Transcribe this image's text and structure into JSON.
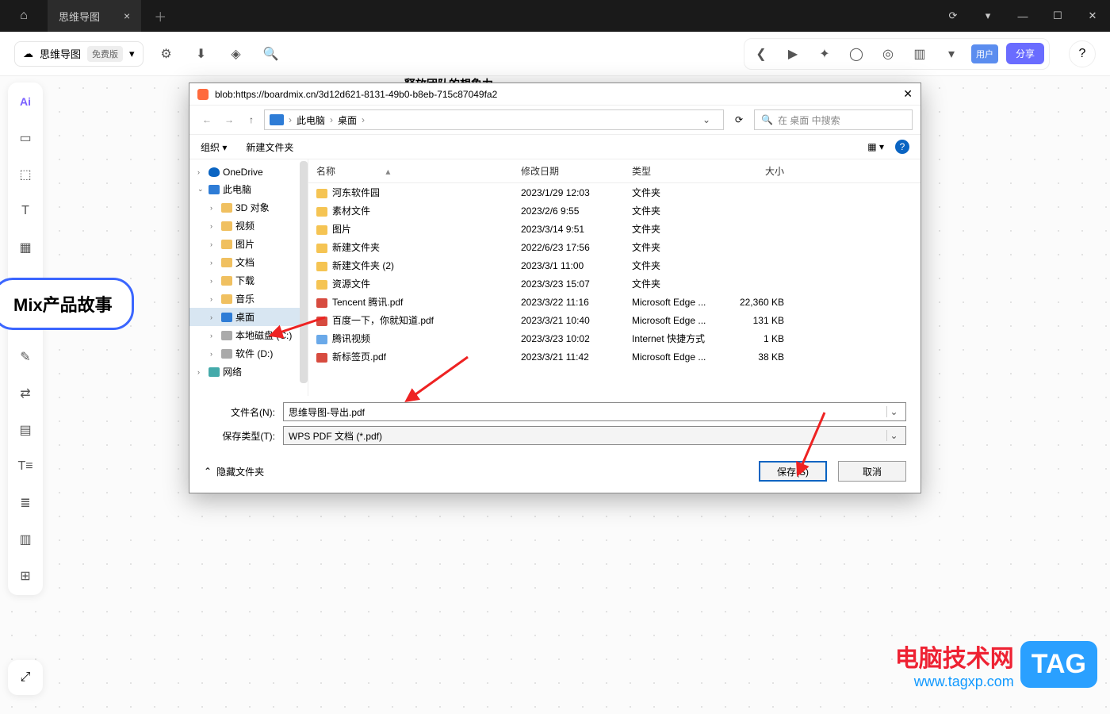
{
  "window": {
    "tab_title": "思维导图",
    "close": "×",
    "plus": "＋",
    "controls": {
      "refresh": "⟳",
      "dropdown": "▾",
      "min": "—",
      "max": "☐",
      "close": "✕"
    }
  },
  "toolbar": {
    "cloud_label": "思维导图",
    "badge": "免费版",
    "chev": "▾",
    "icons": {
      "settings": "⚙",
      "download": "⬇",
      "tag": "◈",
      "search": "🔍"
    },
    "right": {
      "sep": "❮",
      "play": "▶",
      "sparkle": "✦",
      "circle": "◯",
      "target": "◎",
      "chart": "▥",
      "more": "▾"
    },
    "user": "用户",
    "share": "分享",
    "help": "?"
  },
  "palette": [
    "Ai",
    "▭",
    "⬚",
    "T",
    "▦",
    "◯",
    "∫",
    "✎",
    "⇄",
    "▤",
    "T≡",
    "≣",
    "▥",
    "⊞"
  ],
  "corner": "⤢",
  "node_text": "Mix产品故事",
  "canvas_top_text": "释放团队的想象力",
  "dialog": {
    "title_url": "blob:https://boardmix.cn/3d12d621-8131-49b0-b8eb-715c87049fa2",
    "close": "✕",
    "nav": {
      "back": "←",
      "fwd": "→",
      "up": "↑",
      "root": "此电脑",
      "folder": "桌面",
      "sep": "›",
      "dd": "⌄",
      "refresh": "⟳"
    },
    "search_placeholder": "在 桌面 中搜索",
    "search_icon": "🔍",
    "tools": {
      "org": "组织 ▾",
      "newf": "新建文件夹",
      "view": "▦ ▾",
      "help": "?"
    },
    "columns": {
      "name": "名称",
      "date": "修改日期",
      "type": "类型",
      "size": "大小"
    },
    "sort": "▴",
    "tree": [
      {
        "chev": "›",
        "icon": "ic-cloud",
        "label": "OneDrive",
        "depth": 0
      },
      {
        "chev": "⌄",
        "icon": "ic-pc",
        "label": "此电脑",
        "depth": 0
      },
      {
        "chev": "›",
        "icon": "ic-gen",
        "label": "3D 对象",
        "depth": 1
      },
      {
        "chev": "›",
        "icon": "ic-gen",
        "label": "视频",
        "depth": 1
      },
      {
        "chev": "›",
        "icon": "ic-gen",
        "label": "图片",
        "depth": 1
      },
      {
        "chev": "›",
        "icon": "ic-gen",
        "label": "文档",
        "depth": 1
      },
      {
        "chev": "›",
        "icon": "ic-gen",
        "label": "下载",
        "depth": 1
      },
      {
        "chev": "›",
        "icon": "ic-gen",
        "label": "音乐",
        "depth": 1
      },
      {
        "chev": "›",
        "icon": "ic-pc",
        "label": "桌面",
        "depth": 1,
        "sel": true
      },
      {
        "chev": "›",
        "icon": "ic-disk",
        "label": "本地磁盘 (C:)",
        "depth": 1
      },
      {
        "chev": "›",
        "icon": "ic-disk",
        "label": "软件 (D:)",
        "depth": 1
      },
      {
        "chev": "›",
        "icon": "ic-net",
        "label": "网络",
        "depth": 0
      }
    ],
    "files": [
      {
        "icon": "folder",
        "name": "河东软件园",
        "date": "2023/1/29 12:03",
        "type": "文件夹",
        "size": ""
      },
      {
        "icon": "folder",
        "name": "素材文件",
        "date": "2023/2/6 9:55",
        "type": "文件夹",
        "size": ""
      },
      {
        "icon": "folder",
        "name": "图片",
        "date": "2023/3/14 9:51",
        "type": "文件夹",
        "size": ""
      },
      {
        "icon": "folder",
        "name": "新建文件夹",
        "date": "2022/6/23 17:56",
        "type": "文件夹",
        "size": ""
      },
      {
        "icon": "folder",
        "name": "新建文件夹 (2)",
        "date": "2023/3/1 11:00",
        "type": "文件夹",
        "size": ""
      },
      {
        "icon": "folder",
        "name": "资源文件",
        "date": "2023/3/23 15:07",
        "type": "文件夹",
        "size": ""
      },
      {
        "icon": "pdf",
        "name": "Tencent 腾讯.pdf",
        "date": "2023/3/22 11:16",
        "type": "Microsoft Edge ...",
        "size": "22,360 KB"
      },
      {
        "icon": "pdf",
        "name": "百度一下，你就知道.pdf",
        "date": "2023/3/21 10:40",
        "type": "Microsoft Edge ...",
        "size": "131 KB"
      },
      {
        "icon": "link",
        "name": "腾讯视频",
        "date": "2023/3/23 10:02",
        "type": "Internet 快捷方式",
        "size": "1 KB"
      },
      {
        "icon": "pdf",
        "name": "新标签页.pdf",
        "date": "2023/3/21 11:42",
        "type": "Microsoft Edge ...",
        "size": "38 KB"
      }
    ],
    "filename_label": "文件名(N):",
    "filename_value": "思维导图-导出.pdf",
    "type_label": "保存类型(T):",
    "type_value": "WPS PDF 文档 (*.pdf)",
    "hide": "隐藏文件夹",
    "hide_chev": "⌃",
    "save": "保存(S)",
    "cancel": "取消"
  },
  "watermark": {
    "l1": "电脑技术网",
    "l2": "www.tagxp.com",
    "tag": "TAG"
  }
}
